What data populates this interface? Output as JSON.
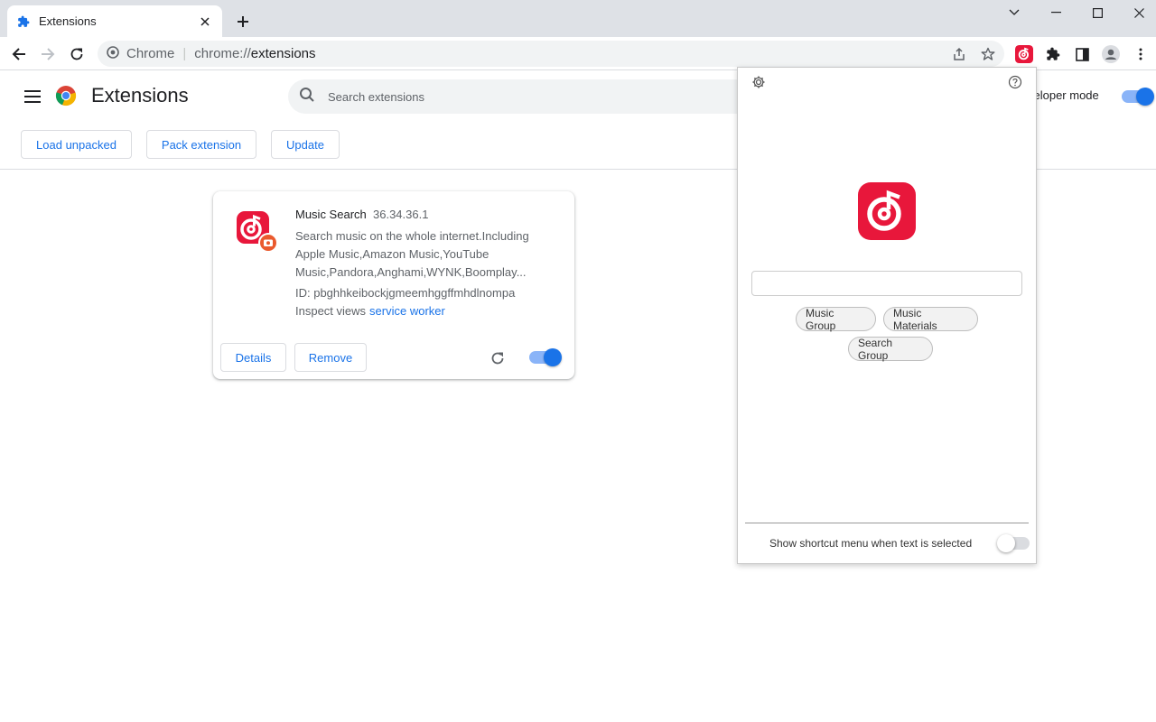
{
  "browser": {
    "tab_title": "Extensions",
    "omnibox_site": "Chrome",
    "omnibox_scheme": "chrome://",
    "omnibox_path": "extensions"
  },
  "header": {
    "title": "Extensions",
    "search_placeholder": "Search extensions",
    "developer_mode_label": "veloper mode",
    "developer_mode_on": true
  },
  "actions": {
    "load_unpacked": "Load unpacked",
    "pack_extension": "Pack extension",
    "update": "Update"
  },
  "extension": {
    "name": "Music Search",
    "version": "36.34.36.1",
    "description": "Search music on the whole internet.Including Apple Music,Amazon Music,YouTube Music,Pandora,Anghami,WYNK,Boomplay...",
    "id_label": "ID: pbghhkeibockjgmeemhggffmhdlnompa",
    "inspect_label": "Inspect views",
    "inspect_link": "service worker",
    "details_label": "Details",
    "remove_label": "Remove",
    "enabled": true
  },
  "popup": {
    "chips": [
      "Music Group",
      "Music Materials",
      "Search Group"
    ],
    "shortcut_label": "Show shortcut menu when text is selected",
    "shortcut_enabled": false
  },
  "colors": {
    "accent": "#1a73e8",
    "brand_red": "#e8173b"
  },
  "icons": [
    "puzzle-icon",
    "close-icon",
    "plus-icon",
    "back-arrow-icon",
    "forward-arrow-icon",
    "reload-icon",
    "share-icon",
    "star-icon",
    "extensions-puzzle-icon",
    "side-panel-icon",
    "profile-icon",
    "kebab-menu-icon",
    "hamburger-icon",
    "search-icon",
    "gear-icon",
    "help-icon"
  ]
}
